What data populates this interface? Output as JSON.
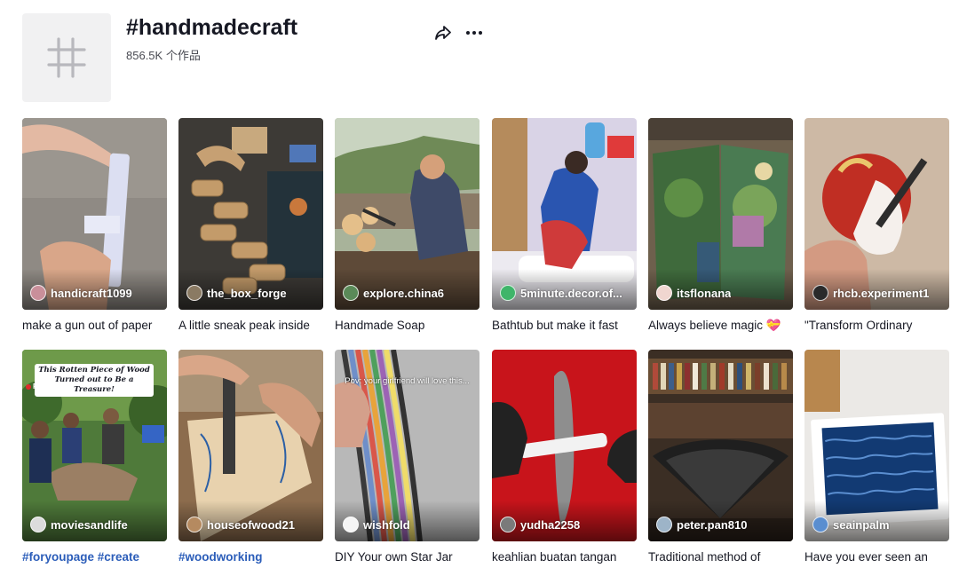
{
  "header": {
    "title": "#handmadecraft",
    "count_label": "856.5K 个作品",
    "avatar_icon": "hashtag-icon",
    "share_icon": "share-arrow-icon",
    "more_icon": "more-dots-icon"
  },
  "colors": {
    "text": "#161823",
    "secondary_text": "#4a4b53",
    "hashtag_link": "#2b5db9",
    "avatar_bg": "#f1f1f2"
  },
  "videos": [
    {
      "author": "handicraft1099",
      "caption": "make a gun out of paper",
      "caption_tags": ""
    },
    {
      "author": "the_box_forge",
      "caption": "A little sneak peak inside",
      "caption_tags": ""
    },
    {
      "author": "explore.china6",
      "caption": "Handmade Soap",
      "caption_tags": ""
    },
    {
      "author": "5minute.decor.of...",
      "caption": "Bathtub but make it fast",
      "caption_tags": ""
    },
    {
      "author": "itsflonana",
      "caption": "Always believe magic 💝",
      "caption_tags": ""
    },
    {
      "author": "rhcb.experiment1",
      "caption": "\"Transform Ordinary",
      "caption_tags": ""
    },
    {
      "author": "moviesandlife",
      "caption": "",
      "caption_tags": "#foryoupage #create",
      "overlay_line1": "This Rotten Piece of Wood",
      "overlay_line2": "Turned out to Be a Treasure!",
      "overlay_rec": "REC"
    },
    {
      "author": "houseofwood21",
      "caption": "",
      "caption_tags": "#woodworking"
    },
    {
      "author": "wishfold",
      "caption": "DIY Your own Star Jar",
      "caption_tags": "",
      "overlay_text": "Pov: your girlfriend will love this..."
    },
    {
      "author": "yudha2258",
      "caption": "keahlian buatan tangan",
      "caption_tags": ""
    },
    {
      "author": "peter.pan810",
      "caption": "Traditional method of",
      "caption_tags": ""
    },
    {
      "author": "seainpalm",
      "caption": "Have you ever seen an",
      "caption_tags": ""
    }
  ]
}
